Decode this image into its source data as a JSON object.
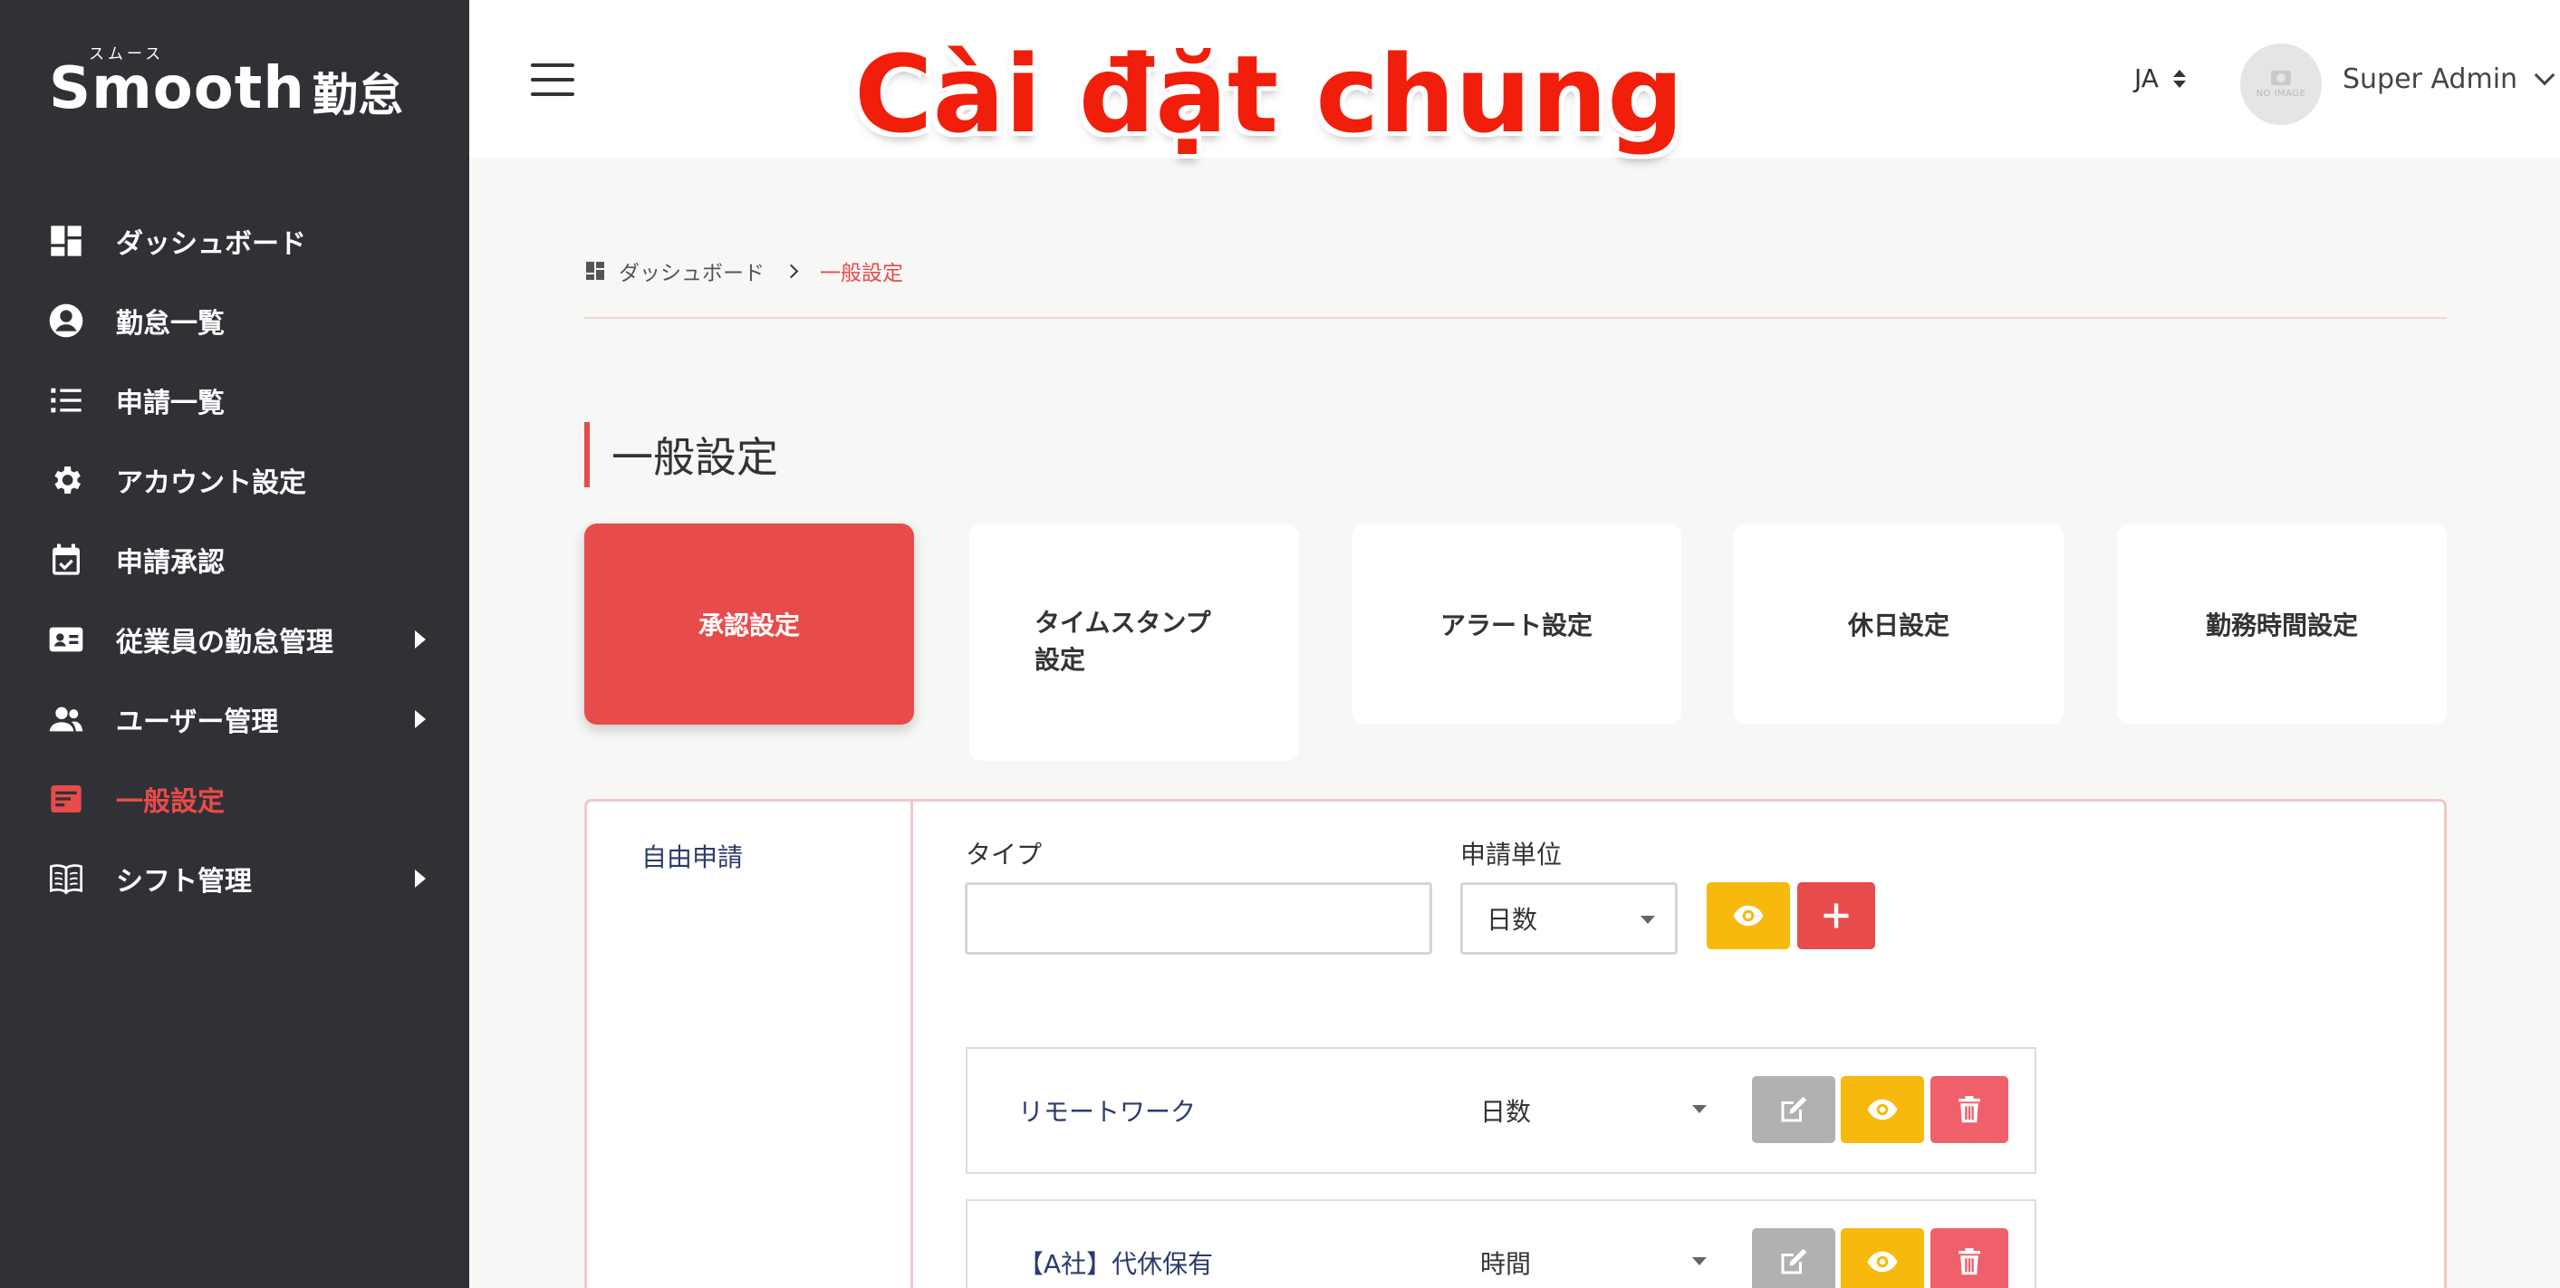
{
  "logo": {
    "brand": "Smooth",
    "kana": "スムース",
    "jp": "勤怠"
  },
  "sidebar": {
    "items": [
      {
        "label": "ダッシュボード",
        "icon": "dashboard-icon",
        "arrow": false,
        "active": false
      },
      {
        "label": "勤怠一覧",
        "icon": "user-circle-icon",
        "arrow": false,
        "active": false
      },
      {
        "label": "申請一覧",
        "icon": "list-icon",
        "arrow": false,
        "active": false
      },
      {
        "label": "アカウント設定",
        "icon": "gear-icon",
        "arrow": false,
        "active": false
      },
      {
        "label": "申請承認",
        "icon": "calendar-check-icon",
        "arrow": false,
        "active": false
      },
      {
        "label": "従業員の勤怠管理",
        "icon": "id-card-icon",
        "arrow": true,
        "active": false
      },
      {
        "label": "ユーザー管理",
        "icon": "users-icon",
        "arrow": true,
        "active": false
      },
      {
        "label": "一般設定",
        "icon": "settings-card-icon",
        "arrow": false,
        "active": true
      },
      {
        "label": "シフト管理",
        "icon": "book-icon",
        "arrow": true,
        "active": false
      }
    ]
  },
  "header": {
    "overlay_title": "Cài đặt chung",
    "language": "JA",
    "avatar_text": "NO IMAGE",
    "user_name": "Super Admin"
  },
  "breadcrumb": {
    "home": "ダッシュボード",
    "current": "一般設定"
  },
  "page": {
    "title": "一般設定"
  },
  "tabs": [
    {
      "label": "承認設定",
      "active": true
    },
    {
      "label_line1": "タイムスタンプ",
      "label_line2": "設定",
      "active": false
    },
    {
      "label": "アラート設定",
      "active": false
    },
    {
      "label": "休日設定",
      "active": false
    },
    {
      "label": "勤務時間設定",
      "active": false
    }
  ],
  "panel": {
    "section_label": "自由申請",
    "type_label": "タイプ",
    "type_value": "",
    "unit_label": "申請単位",
    "unit_value": "日数",
    "rows": [
      {
        "name": "リモートワーク",
        "unit": "日数"
      },
      {
        "name": "【A社】代休保有",
        "unit": "時間"
      }
    ]
  },
  "colors": {
    "accent": "#e84b4b",
    "sidebar": "#303136",
    "yellow": "#f7b90e",
    "grey": "#b1b1b1"
  }
}
